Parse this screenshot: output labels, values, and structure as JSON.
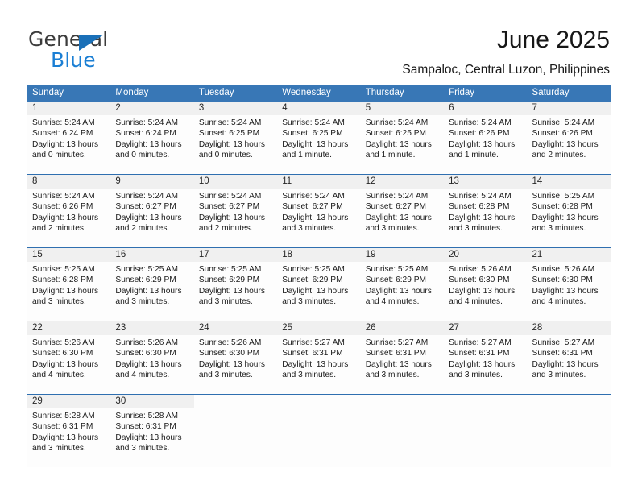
{
  "brand": {
    "name_part1": "General",
    "name_part2": "Blue",
    "triangle_color": "#1a70b8",
    "blue_color": "#1b7fd4"
  },
  "header": {
    "title": "June 2025",
    "subtitle": "Sampaloc, Central Luzon, Philippines"
  },
  "calendar": {
    "header_bg": "#3877b6",
    "daynum_bg": "#f0f0f0",
    "separator_color": "#2f6fb0",
    "weekdays": [
      "Sunday",
      "Monday",
      "Tuesday",
      "Wednesday",
      "Thursday",
      "Friday",
      "Saturday"
    ],
    "weeks": [
      [
        {
          "day": "1",
          "sunrise": "Sunrise: 5:24 AM",
          "sunset": "Sunset: 6:24 PM",
          "daylight1": "Daylight: 13 hours",
          "daylight2": "and 0 minutes."
        },
        {
          "day": "2",
          "sunrise": "Sunrise: 5:24 AM",
          "sunset": "Sunset: 6:24 PM",
          "daylight1": "Daylight: 13 hours",
          "daylight2": "and 0 minutes."
        },
        {
          "day": "3",
          "sunrise": "Sunrise: 5:24 AM",
          "sunset": "Sunset: 6:25 PM",
          "daylight1": "Daylight: 13 hours",
          "daylight2": "and 0 minutes."
        },
        {
          "day": "4",
          "sunrise": "Sunrise: 5:24 AM",
          "sunset": "Sunset: 6:25 PM",
          "daylight1": "Daylight: 13 hours",
          "daylight2": "and 1 minute."
        },
        {
          "day": "5",
          "sunrise": "Sunrise: 5:24 AM",
          "sunset": "Sunset: 6:25 PM",
          "daylight1": "Daylight: 13 hours",
          "daylight2": "and 1 minute."
        },
        {
          "day": "6",
          "sunrise": "Sunrise: 5:24 AM",
          "sunset": "Sunset: 6:26 PM",
          "daylight1": "Daylight: 13 hours",
          "daylight2": "and 1 minute."
        },
        {
          "day": "7",
          "sunrise": "Sunrise: 5:24 AM",
          "sunset": "Sunset: 6:26 PM",
          "daylight1": "Daylight: 13 hours",
          "daylight2": "and 2 minutes."
        }
      ],
      [
        {
          "day": "8",
          "sunrise": "Sunrise: 5:24 AM",
          "sunset": "Sunset: 6:26 PM",
          "daylight1": "Daylight: 13 hours",
          "daylight2": "and 2 minutes."
        },
        {
          "day": "9",
          "sunrise": "Sunrise: 5:24 AM",
          "sunset": "Sunset: 6:27 PM",
          "daylight1": "Daylight: 13 hours",
          "daylight2": "and 2 minutes."
        },
        {
          "day": "10",
          "sunrise": "Sunrise: 5:24 AM",
          "sunset": "Sunset: 6:27 PM",
          "daylight1": "Daylight: 13 hours",
          "daylight2": "and 2 minutes."
        },
        {
          "day": "11",
          "sunrise": "Sunrise: 5:24 AM",
          "sunset": "Sunset: 6:27 PM",
          "daylight1": "Daylight: 13 hours",
          "daylight2": "and 3 minutes."
        },
        {
          "day": "12",
          "sunrise": "Sunrise: 5:24 AM",
          "sunset": "Sunset: 6:27 PM",
          "daylight1": "Daylight: 13 hours",
          "daylight2": "and 3 minutes."
        },
        {
          "day": "13",
          "sunrise": "Sunrise: 5:24 AM",
          "sunset": "Sunset: 6:28 PM",
          "daylight1": "Daylight: 13 hours",
          "daylight2": "and 3 minutes."
        },
        {
          "day": "14",
          "sunrise": "Sunrise: 5:25 AM",
          "sunset": "Sunset: 6:28 PM",
          "daylight1": "Daylight: 13 hours",
          "daylight2": "and 3 minutes."
        }
      ],
      [
        {
          "day": "15",
          "sunrise": "Sunrise: 5:25 AM",
          "sunset": "Sunset: 6:28 PM",
          "daylight1": "Daylight: 13 hours",
          "daylight2": "and 3 minutes."
        },
        {
          "day": "16",
          "sunrise": "Sunrise: 5:25 AM",
          "sunset": "Sunset: 6:29 PM",
          "daylight1": "Daylight: 13 hours",
          "daylight2": "and 3 minutes."
        },
        {
          "day": "17",
          "sunrise": "Sunrise: 5:25 AM",
          "sunset": "Sunset: 6:29 PM",
          "daylight1": "Daylight: 13 hours",
          "daylight2": "and 3 minutes."
        },
        {
          "day": "18",
          "sunrise": "Sunrise: 5:25 AM",
          "sunset": "Sunset: 6:29 PM",
          "daylight1": "Daylight: 13 hours",
          "daylight2": "and 3 minutes."
        },
        {
          "day": "19",
          "sunrise": "Sunrise: 5:25 AM",
          "sunset": "Sunset: 6:29 PM",
          "daylight1": "Daylight: 13 hours",
          "daylight2": "and 4 minutes."
        },
        {
          "day": "20",
          "sunrise": "Sunrise: 5:26 AM",
          "sunset": "Sunset: 6:30 PM",
          "daylight1": "Daylight: 13 hours",
          "daylight2": "and 4 minutes."
        },
        {
          "day": "21",
          "sunrise": "Sunrise: 5:26 AM",
          "sunset": "Sunset: 6:30 PM",
          "daylight1": "Daylight: 13 hours",
          "daylight2": "and 4 minutes."
        }
      ],
      [
        {
          "day": "22",
          "sunrise": "Sunrise: 5:26 AM",
          "sunset": "Sunset: 6:30 PM",
          "daylight1": "Daylight: 13 hours",
          "daylight2": "and 4 minutes."
        },
        {
          "day": "23",
          "sunrise": "Sunrise: 5:26 AM",
          "sunset": "Sunset: 6:30 PM",
          "daylight1": "Daylight: 13 hours",
          "daylight2": "and 4 minutes."
        },
        {
          "day": "24",
          "sunrise": "Sunrise: 5:26 AM",
          "sunset": "Sunset: 6:30 PM",
          "daylight1": "Daylight: 13 hours",
          "daylight2": "and 3 minutes."
        },
        {
          "day": "25",
          "sunrise": "Sunrise: 5:27 AM",
          "sunset": "Sunset: 6:31 PM",
          "daylight1": "Daylight: 13 hours",
          "daylight2": "and 3 minutes."
        },
        {
          "day": "26",
          "sunrise": "Sunrise: 5:27 AM",
          "sunset": "Sunset: 6:31 PM",
          "daylight1": "Daylight: 13 hours",
          "daylight2": "and 3 minutes."
        },
        {
          "day": "27",
          "sunrise": "Sunrise: 5:27 AM",
          "sunset": "Sunset: 6:31 PM",
          "daylight1": "Daylight: 13 hours",
          "daylight2": "and 3 minutes."
        },
        {
          "day": "28",
          "sunrise": "Sunrise: 5:27 AM",
          "sunset": "Sunset: 6:31 PM",
          "daylight1": "Daylight: 13 hours",
          "daylight2": "and 3 minutes."
        }
      ],
      [
        {
          "day": "29",
          "sunrise": "Sunrise: 5:28 AM",
          "sunset": "Sunset: 6:31 PM",
          "daylight1": "Daylight: 13 hours",
          "daylight2": "and 3 minutes."
        },
        {
          "day": "30",
          "sunrise": "Sunrise: 5:28 AM",
          "sunset": "Sunset: 6:31 PM",
          "daylight1": "Daylight: 13 hours",
          "daylight2": "and 3 minutes."
        },
        {
          "day": "",
          "sunrise": "",
          "sunset": "",
          "daylight1": "",
          "daylight2": ""
        },
        {
          "day": "",
          "sunrise": "",
          "sunset": "",
          "daylight1": "",
          "daylight2": ""
        },
        {
          "day": "",
          "sunrise": "",
          "sunset": "",
          "daylight1": "",
          "daylight2": ""
        },
        {
          "day": "",
          "sunrise": "",
          "sunset": "",
          "daylight1": "",
          "daylight2": ""
        },
        {
          "day": "",
          "sunrise": "",
          "sunset": "",
          "daylight1": "",
          "daylight2": ""
        }
      ]
    ]
  }
}
